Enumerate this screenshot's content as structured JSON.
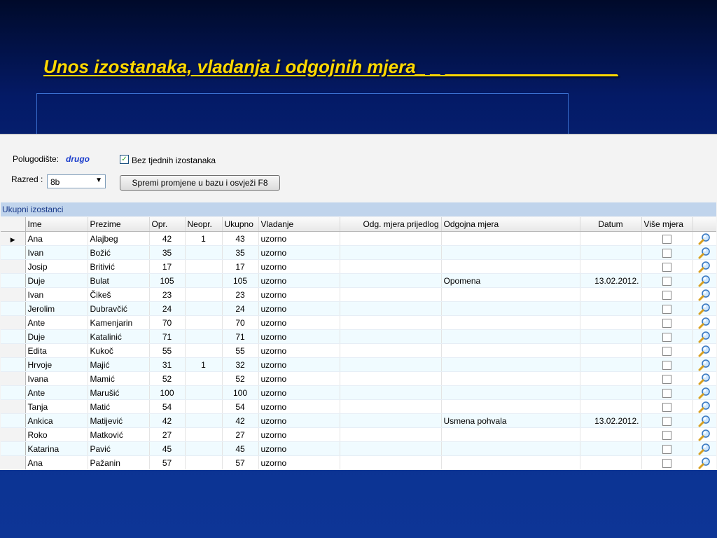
{
  "slide": {
    "title": "Unos izostanaka, vladanja i odgojnih mjera_ _ _________________"
  },
  "form": {
    "semester_label": "Polugodište:",
    "semester_value": "drugo",
    "no_weekly_absences_label": "Bez tjednih izostanaka",
    "no_weekly_absences_checked": true,
    "class_label": "Razred :",
    "class_value": "8b",
    "save_button_label": "Spremi promjene u bazu i osvježi  F8"
  },
  "grid": {
    "caption": "Ukupni izostanci",
    "columns": [
      "Ime",
      "Prezime",
      "Opr.",
      "Neopr.",
      "Ukupno",
      "Vladanje",
      "Odg. mjera prijedlog",
      "Odgojna mjera",
      "Datum",
      "Više mjera"
    ],
    "current_row_marker": "▶",
    "rows": [
      {
        "ime": "Ana",
        "prezime": "Alajbeg",
        "opr": "42",
        "neopr": "1",
        "ukupno": "43",
        "vladanje": "uzorno",
        "prijedlog": "",
        "mjera": "",
        "datum": ""
      },
      {
        "ime": "Ivan",
        "prezime": "Božić",
        "opr": "35",
        "neopr": "",
        "ukupno": "35",
        "vladanje": "uzorno",
        "prijedlog": "",
        "mjera": "",
        "datum": ""
      },
      {
        "ime": "Josip",
        "prezime": "Britivić",
        "opr": "17",
        "neopr": "",
        "ukupno": "17",
        "vladanje": "uzorno",
        "prijedlog": "",
        "mjera": "",
        "datum": ""
      },
      {
        "ime": "Duje",
        "prezime": "Bulat",
        "opr": "105",
        "neopr": "",
        "ukupno": "105",
        "vladanje": "uzorno",
        "prijedlog": "",
        "mjera": "Opomena",
        "datum": "13.02.2012."
      },
      {
        "ime": "Ivan",
        "prezime": "Čikeš",
        "opr": "23",
        "neopr": "",
        "ukupno": "23",
        "vladanje": "uzorno",
        "prijedlog": "",
        "mjera": "",
        "datum": ""
      },
      {
        "ime": "Jerolim",
        "prezime": "Dubravčić",
        "opr": "24",
        "neopr": "",
        "ukupno": "24",
        "vladanje": "uzorno",
        "prijedlog": "",
        "mjera": "",
        "datum": ""
      },
      {
        "ime": "Ante",
        "prezime": "Kamenjarin",
        "opr": "70",
        "neopr": "",
        "ukupno": "70",
        "vladanje": "uzorno",
        "prijedlog": "",
        "mjera": "",
        "datum": ""
      },
      {
        "ime": "Duje",
        "prezime": "Katalinić",
        "opr": "71",
        "neopr": "",
        "ukupno": "71",
        "vladanje": "uzorno",
        "prijedlog": "",
        "mjera": "",
        "datum": ""
      },
      {
        "ime": "Edita",
        "prezime": "Kukoč",
        "opr": "55",
        "neopr": "",
        "ukupno": "55",
        "vladanje": "uzorno",
        "prijedlog": "",
        "mjera": "",
        "datum": ""
      },
      {
        "ime": "Hrvoje",
        "prezime": "Majić",
        "opr": "31",
        "neopr": "1",
        "ukupno": "32",
        "vladanje": "uzorno",
        "prijedlog": "",
        "mjera": "",
        "datum": ""
      },
      {
        "ime": "Ivana",
        "prezime": "Mamić",
        "opr": "52",
        "neopr": "",
        "ukupno": "52",
        "vladanje": "uzorno",
        "prijedlog": "",
        "mjera": "",
        "datum": ""
      },
      {
        "ime": "Ante",
        "prezime": "Marušić",
        "opr": "100",
        "neopr": "",
        "ukupno": "100",
        "vladanje": "uzorno",
        "prijedlog": "",
        "mjera": "",
        "datum": ""
      },
      {
        "ime": "Tanja",
        "prezime": "Matić",
        "opr": "54",
        "neopr": "",
        "ukupno": "54",
        "vladanje": "uzorno",
        "prijedlog": "",
        "mjera": "",
        "datum": ""
      },
      {
        "ime": "Ankica",
        "prezime": "Matijević",
        "opr": "42",
        "neopr": "",
        "ukupno": "42",
        "vladanje": "uzorno",
        "prijedlog": "",
        "mjera": "Usmena pohvala",
        "datum": "13.02.2012."
      },
      {
        "ime": "Roko",
        "prezime": "Matković",
        "opr": "27",
        "neopr": "",
        "ukupno": "27",
        "vladanje": "uzorno",
        "prijedlog": "",
        "mjera": "",
        "datum": ""
      },
      {
        "ime": "Katarina",
        "prezime": "Pavić",
        "opr": "45",
        "neopr": "",
        "ukupno": "45",
        "vladanje": "uzorno",
        "prijedlog": "",
        "mjera": "",
        "datum": ""
      },
      {
        "ime": "Ana",
        "prezime": "Pažanin",
        "opr": "57",
        "neopr": "",
        "ukupno": "57",
        "vladanje": "uzorno",
        "prijedlog": "",
        "mjera": "",
        "datum": ""
      }
    ]
  },
  "icons": {
    "row_action": "magnifier-icon",
    "checkbox_mark": "✓"
  },
  "colors": {
    "title": "#ffd800",
    "semester_value": "#1a3ccc",
    "caption_bg": "#c0d4ec",
    "alt_row": "#f0fbff"
  }
}
